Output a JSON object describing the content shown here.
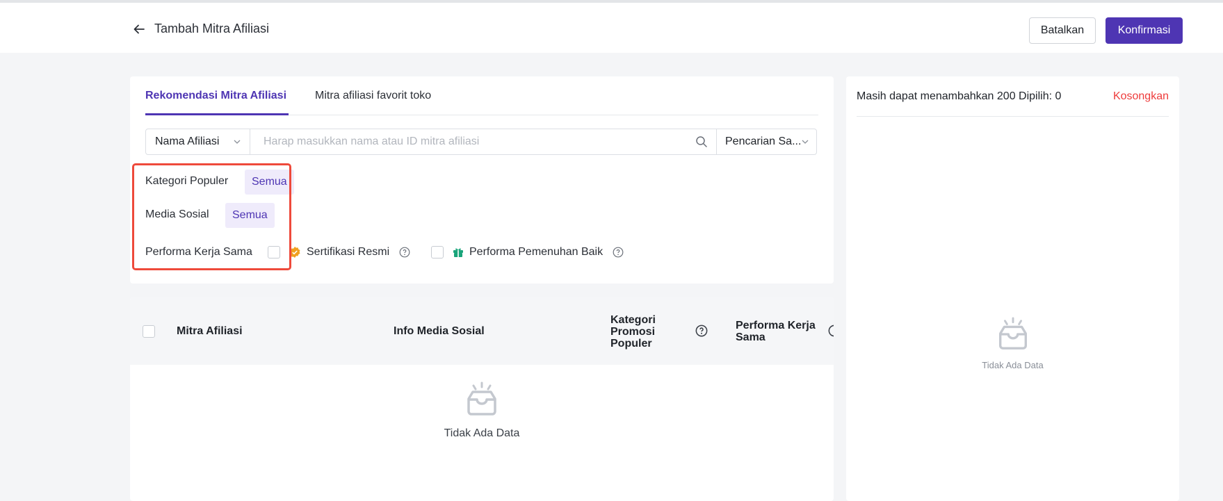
{
  "header": {
    "back_icon": "arrow-left-icon",
    "title": "Tambah Mitra Afiliasi",
    "cancel_label": "Batalkan",
    "confirm_label": "Konfirmasi"
  },
  "tabs": [
    {
      "label": "Rekomendasi Mitra Afiliasi",
      "active": true
    },
    {
      "label": "Mitra afiliasi favorit toko",
      "active": false
    }
  ],
  "search": {
    "field_selected": "Nama Afiliasi",
    "placeholder": "Harap masukkan nama atau ID mitra afiliasi",
    "value": "",
    "mode_selected": "Pencarian Sa..."
  },
  "filters": {
    "category": {
      "label": "Kategori Populer",
      "chip": "Semua"
    },
    "social": {
      "label": "Media Sosial",
      "chip": "Semua"
    },
    "performance": {
      "label": "Performa Kerja Sama",
      "options": [
        {
          "label": "Sertifikasi Resmi",
          "icon": "verified-badge-icon",
          "checked": false
        },
        {
          "label": "Performa Pemenuhan Baik",
          "icon": "gift-icon",
          "checked": false
        }
      ]
    }
  },
  "table": {
    "columns": [
      "Mitra Afiliasi",
      "Info Media Sosial",
      "Kategori Promosi Populer",
      "Performa Kerja Sama"
    ],
    "column_lines": {
      "category": [
        "Kategori",
        "Promosi",
        "Populer"
      ],
      "performance": [
        "Performa Kerja",
        "Sama"
      ]
    },
    "empty_text": "Tidak Ada Data"
  },
  "selection": {
    "summary": "Masih dapat menambahkan 200 Dipilih: 0",
    "clear_label": "Kosongkan",
    "empty_text": "Tidak Ada Data"
  },
  "colors": {
    "accent": "#4e35b3",
    "danger": "#ee3b3b",
    "highlight": "#ee4a3b"
  }
}
